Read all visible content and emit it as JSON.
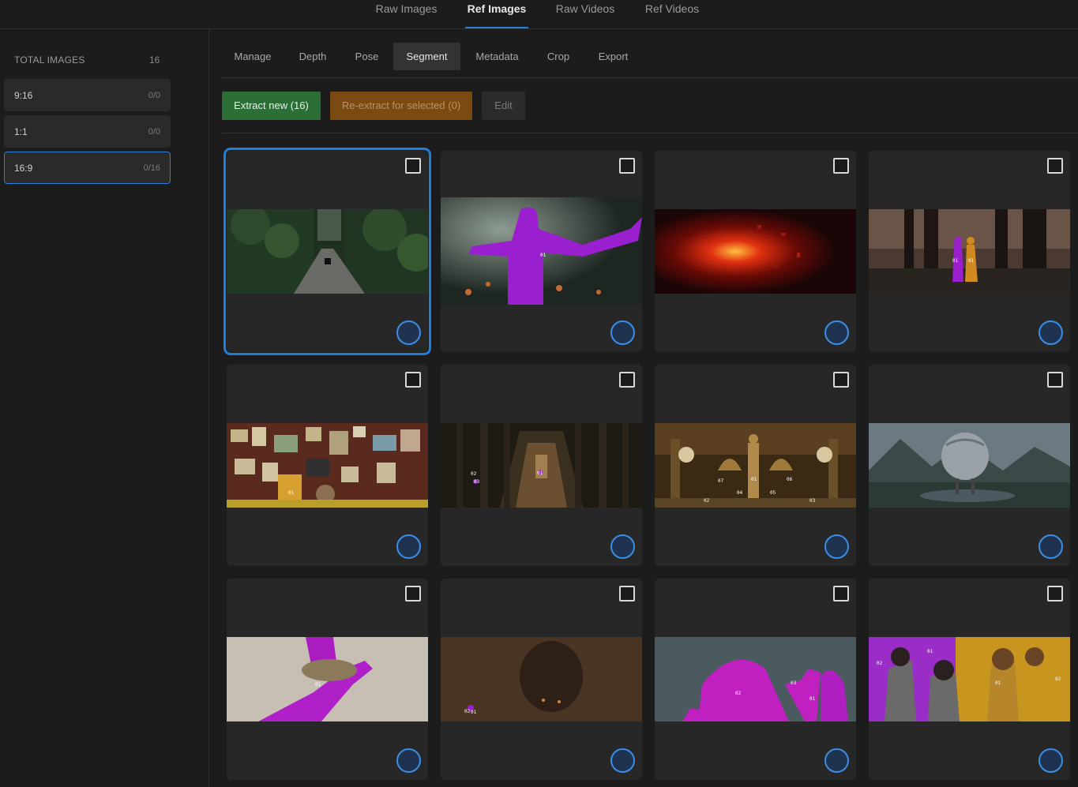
{
  "top_tabs": [
    "Raw Images",
    "Ref Images",
    "Raw Videos",
    "Ref Videos"
  ],
  "active_top_tab": "Ref Images",
  "sidebar": {
    "total_label": "TOTAL IMAGES",
    "total_count": "16",
    "ratios": [
      {
        "label": "9:16",
        "count": "0/0"
      },
      {
        "label": "1:1",
        "count": "0/0"
      },
      {
        "label": "16:9",
        "count": "0/16",
        "selected": true
      }
    ]
  },
  "sub_tabs": [
    "Manage",
    "Depth",
    "Pose",
    "Segment",
    "Metadata",
    "Crop",
    "Export"
  ],
  "active_sub_tab": "Segment",
  "actions": {
    "extract_label": "Extract new (16)",
    "reextract_label": "Re-extract for selected (0)",
    "edit_label": "Edit"
  },
  "colors": {
    "accent": "#1d7fe0",
    "extract_green": "#2b6e36",
    "reextract_orange": "#7a4a12",
    "segment_magenta": "#a020c8",
    "segment_gold": "#c8901e"
  },
  "cards": [
    {
      "scene": "forest-road",
      "selected": true,
      "labels": []
    },
    {
      "scene": "person-arms-spread",
      "labels": [
        "01"
      ]
    },
    {
      "scene": "red-explosion",
      "labels": []
    },
    {
      "scene": "two-figures-pillars",
      "labels": [
        "01",
        "01"
      ]
    },
    {
      "scene": "corkboard-wall",
      "labels": [
        "01"
      ]
    },
    {
      "scene": "columned-hallway",
      "labels": [
        "02",
        "03",
        "01"
      ]
    },
    {
      "scene": "ornate-opera-hall",
      "labels": [
        "07",
        "01",
        "06",
        "02",
        "04",
        "05",
        "03"
      ]
    },
    {
      "scene": "sphere-landscape",
      "labels": []
    },
    {
      "scene": "hand-with-sand",
      "labels": [
        "01"
      ]
    },
    {
      "scene": "foggy-dark-ship",
      "labels": [
        "02",
        "01"
      ]
    },
    {
      "scene": "hooded-figures",
      "labels": [
        "02",
        "03",
        "01"
      ]
    },
    {
      "scene": "robed-crowd",
      "labels": [
        "01",
        "02",
        "01",
        "02"
      ]
    }
  ]
}
